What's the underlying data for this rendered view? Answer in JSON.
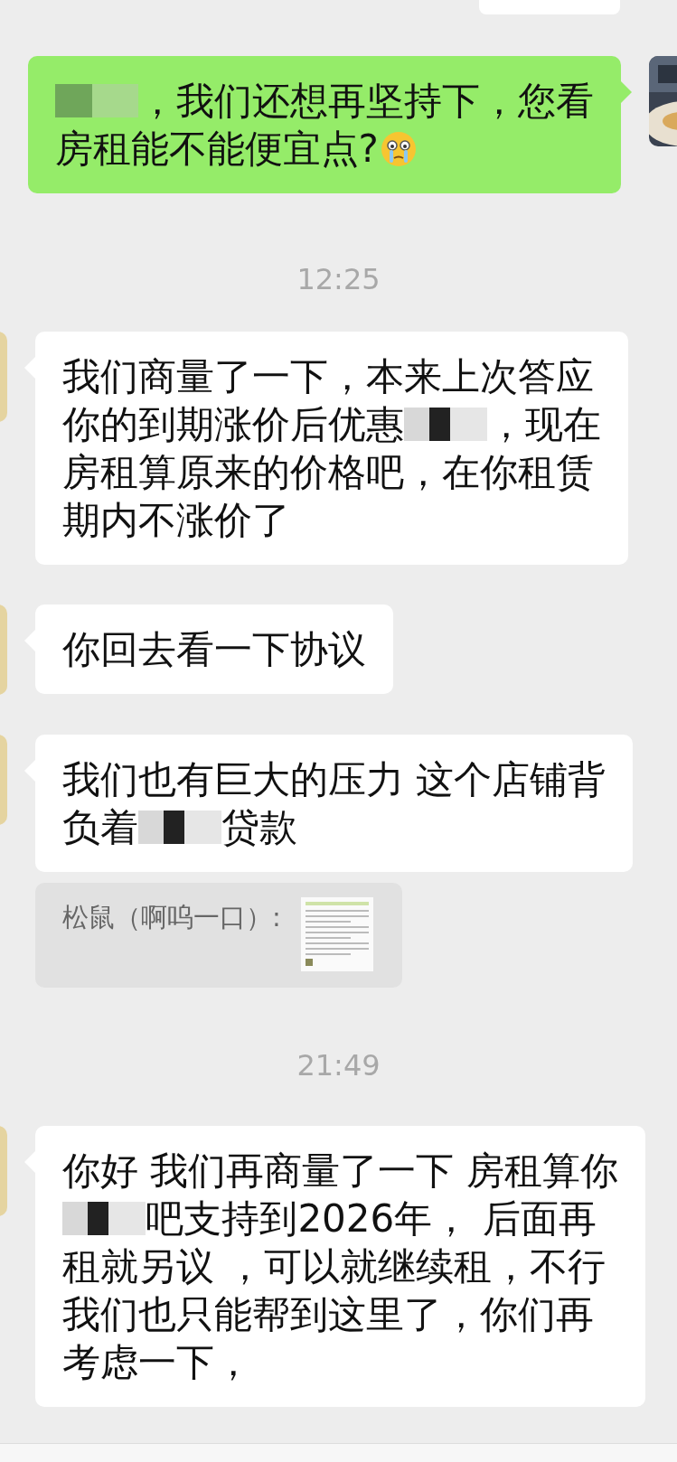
{
  "messages": [
    {
      "kind": "partial"
    },
    {
      "kind": "message",
      "sent": true,
      "lines": [
        [
          {
            "kind": "redaction"
          },
          {
            "kind": "text",
            "text": "，我们还想再坚持下，您看"
          }
        ],
        [
          {
            "kind": "text",
            "text": "房租能不能便宜点?"
          },
          {
            "kind": "emoji"
          }
        ]
      ]
    },
    {
      "kind": "time",
      "text": "12:25"
    },
    {
      "kind": "message",
      "sent": false,
      "lines": [
        [
          {
            "kind": "text",
            "text": "我们商量了一下，本来上次答应"
          }
        ],
        [
          {
            "kind": "text",
            "text": "你的到期涨价后优惠"
          },
          {
            "kind": "redaction"
          },
          {
            "kind": "text",
            "text": "，现在"
          }
        ],
        [
          {
            "kind": "text",
            "text": "房租算原来的价格吧，在你租赁"
          }
        ],
        [
          {
            "kind": "text",
            "text": "期内不涨价了"
          }
        ]
      ]
    },
    {
      "kind": "message",
      "sent": false,
      "lines": [
        [
          {
            "kind": "text",
            "text": "你回去看一下协议"
          }
        ]
      ]
    },
    {
      "kind": "message",
      "sent": false,
      "lines": [
        [
          {
            "kind": "text",
            "text": "我们也有巨大的压力 这个店铺背"
          }
        ],
        [
          {
            "kind": "text",
            "text": "负着"
          },
          {
            "kind": "redaction"
          },
          {
            "kind": "text",
            "text": "贷款"
          }
        ]
      ]
    },
    {
      "kind": "quote",
      "text": "松鼠（啊呜一口）:"
    },
    {
      "kind": "time",
      "text": "21:49"
    },
    {
      "kind": "message",
      "sent": false,
      "lines": [
        [
          {
            "kind": "text",
            "text": "你好 我们再商量了一下 房租算你"
          }
        ],
        [
          {
            "kind": "redaction"
          },
          {
            "kind": "text",
            "text": "吧支持到2026年， 后面再"
          }
        ],
        [
          {
            "kind": "text",
            "text": "租就另议 ，可以就继续租，不行"
          }
        ],
        [
          {
            "kind": "text",
            "text": "我们也只能帮到这里了，你们再"
          }
        ],
        [
          {
            "kind": "text",
            "text": "考虑一下，"
          }
        ]
      ]
    }
  ]
}
